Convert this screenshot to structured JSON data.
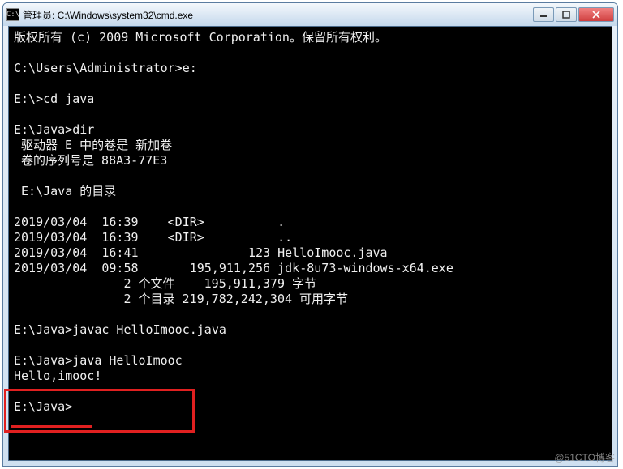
{
  "window": {
    "icon_label": "C:\\",
    "title": "管理员: C:\\Windows\\system32\\cmd.exe"
  },
  "buttons": {
    "minimize": "–",
    "maximize": "□",
    "close": "×"
  },
  "lines": {
    "l0": "版权所有 (c) 2009 Microsoft Corporation。保留所有权利。",
    "l1": "",
    "l2": "C:\\Users\\Administrator>e:",
    "l3": "",
    "l4": "E:\\>cd java",
    "l5": "",
    "l6": "E:\\Java>dir",
    "l7": " 驱动器 E 中的卷是 新加卷",
    "l8": " 卷的序列号是 88A3-77E3",
    "l9": "",
    "l10": " E:\\Java 的目录",
    "l11": "",
    "l12": "2019/03/04  16:39    <DIR>          .",
    "l13": "2019/03/04  16:39    <DIR>          ..",
    "l14": "2019/03/04  16:41               123 HelloImooc.java",
    "l15": "2019/03/04  09:58       195,911,256 jdk-8u73-windows-x64.exe",
    "l16": "               2 个文件    195,911,379 字节",
    "l17": "               2 个目录 219,782,242,304 可用字节",
    "l18": "",
    "l19": "E:\\Java>javac HelloImooc.java",
    "l20": "",
    "l21": "E:\\Java>java HelloImooc",
    "l22": "Hello,imooc!",
    "l23": "",
    "l24": "E:\\Java>"
  },
  "watermark": "@51CTO博客"
}
